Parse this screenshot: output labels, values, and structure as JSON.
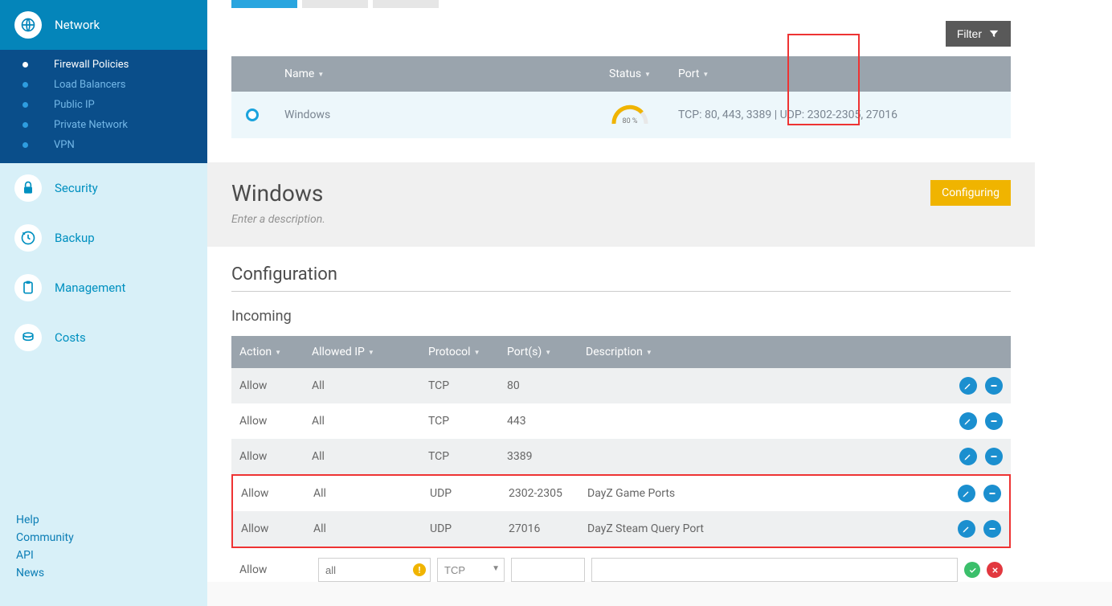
{
  "sidebar": {
    "network": {
      "label": "Network",
      "items": [
        {
          "label": "Firewall Policies",
          "active": true
        },
        {
          "label": "Load Balancers",
          "active": false
        },
        {
          "label": "Public IP",
          "active": false
        },
        {
          "label": "Private Network",
          "active": false
        },
        {
          "label": "VPN",
          "active": false
        }
      ]
    },
    "security": {
      "label": "Security"
    },
    "backup": {
      "label": "Backup"
    },
    "management": {
      "label": "Management"
    },
    "costs": {
      "label": "Costs"
    },
    "footer": [
      "Help",
      "Community",
      "API",
      "News"
    ]
  },
  "filter": {
    "label": "Filter"
  },
  "policies": {
    "cols": {
      "name": "Name",
      "status": "Status",
      "port": "Port"
    },
    "rows": [
      {
        "name": "Windows",
        "progress": "80 %",
        "port": "TCP: 80, 443, 3389 | UDP: 2302-2305, 27016"
      }
    ]
  },
  "detail": {
    "title": "Windows",
    "desc_placeholder": "Enter a description.",
    "badge": "Configuring",
    "config_heading": "Configuration",
    "incoming_heading": "Incoming"
  },
  "rules": {
    "cols": {
      "action": "Action",
      "ip": "Allowed IP",
      "proto": "Protocol",
      "ports": "Port(s)",
      "desc": "Description"
    },
    "rows": [
      {
        "action": "Allow",
        "ip": "All",
        "proto": "TCP",
        "ports": "80",
        "desc": ""
      },
      {
        "action": "Allow",
        "ip": "All",
        "proto": "TCP",
        "ports": "443",
        "desc": ""
      },
      {
        "action": "Allow",
        "ip": "All",
        "proto": "TCP",
        "ports": "3389",
        "desc": ""
      },
      {
        "action": "Allow",
        "ip": "All",
        "proto": "UDP",
        "ports": "2302-2305",
        "desc": "DayZ Game Ports"
      },
      {
        "action": "Allow",
        "ip": "All",
        "proto": "UDP",
        "ports": "27016",
        "desc": "DayZ Steam Query Port"
      }
    ]
  },
  "newrule": {
    "action": "Allow",
    "ip_placeholder": "all",
    "proto": "TCP",
    "ports": "",
    "desc": ""
  }
}
